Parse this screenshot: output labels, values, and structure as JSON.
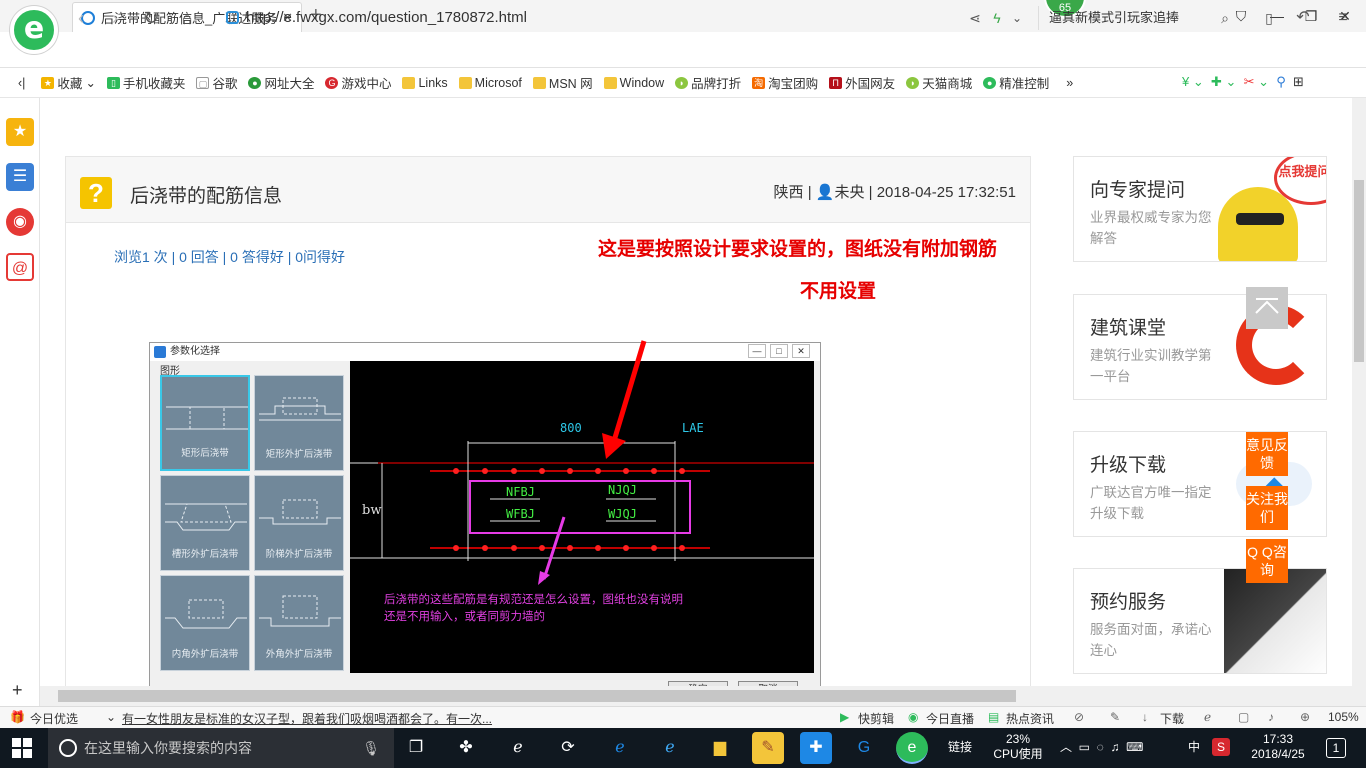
{
  "browser": {
    "tab_title": "后浇带的配筋信息_广联达服务新",
    "new_tab_label": "+",
    "badge_count": "65",
    "url": "http://e.fwxgx.com/question_1780872.html",
    "search_text": "逼真新模式引玩家追捧",
    "bookmarks": [
      "收藏",
      "手机收藏夹",
      "谷歌",
      "网址大全",
      "游戏中心",
      "Links",
      "Microsof",
      "MSN 网",
      "Window",
      "品牌打折",
      "淘宝团购",
      "外国网友",
      "天猫商城",
      "精准控制"
    ],
    "bookmarks_more": "»"
  },
  "question": {
    "title": "后浇带的配筋信息",
    "location": "陕西",
    "author": "未央",
    "datetime": "2018-04-25 17:32:51",
    "stats": "浏览1 次 | 0 回答 | 0 答得好 | 0问得好"
  },
  "annotation": {
    "line1": "这是要按照设计要求设置的，图纸没有附加钢筋",
    "line2": "不用设置"
  },
  "dialog": {
    "title": "参数化选择",
    "group_label": "图形",
    "shapes": [
      "矩形后浇带",
      "矩形外扩后浇带",
      "槽形外扩后浇带",
      "阶梯外扩后浇带",
      "内角外扩后浇带",
      "外角外扩后浇带"
    ],
    "ok_label": "确定",
    "cancel_label": "取消",
    "cad": {
      "dim_800": "800",
      "dim_lae": "LAE",
      "bw": "bw",
      "nfbj": "NFBJ",
      "njqj": "NJQJ",
      "wfbj": "WFBJ",
      "wjqj": "WJQJ",
      "note_line1": "后浇带的这些配筋是有规范还是怎么设置，图纸也没有说明",
      "note_line2": "还是不用输入，或者同剪力墙的"
    }
  },
  "sidebar": {
    "cards": [
      {
        "title": "向专家提问",
        "sub": "业界最权威专家为您解答",
        "badge": "点我提问哦"
      },
      {
        "title": "建筑课堂",
        "sub": "建筑行业实训教学第一平台"
      },
      {
        "title": "升级下载",
        "sub": "广联达官方唯一指定升级下载"
      },
      {
        "title": "预约服务",
        "sub": "服务面对面，承诺心连心"
      }
    ],
    "floats": [
      "意见反馈",
      "关注我们",
      "Q Q咨询"
    ]
  },
  "statusbar": {
    "daily": "今日优选",
    "news": "有一女性朋友是标准的女汉子型，跟着我们吸烟喝酒都会了。有一次...",
    "quick_cut": "快剪辑",
    "live": "今日直播",
    "hot": "热点资讯",
    "download": "下载",
    "zoom": "105%"
  },
  "taskbar": {
    "search_placeholder": "在这里输入你要搜索的内容",
    "link_label": "链接",
    "cpu_percent": "23%",
    "cpu_label": "CPU使用",
    "ime": "中",
    "time": "17:33",
    "date": "2018/4/25",
    "notifications": "1"
  }
}
